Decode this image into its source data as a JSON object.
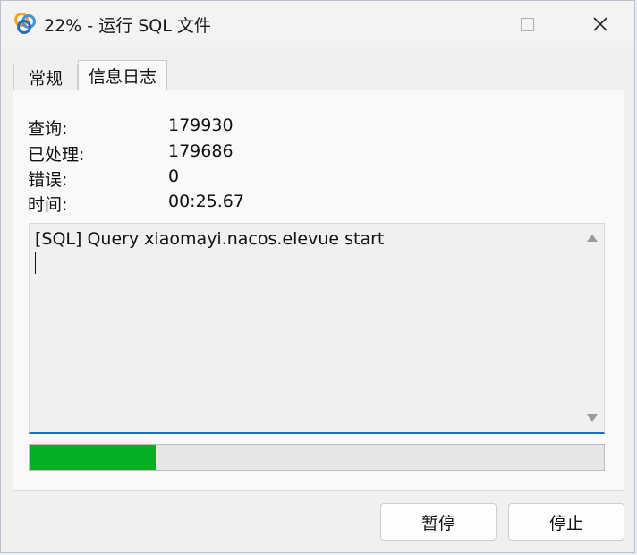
{
  "window": {
    "title": "22% - 运行 SQL 文件"
  },
  "tabs": [
    {
      "label": "常规",
      "active": false
    },
    {
      "label": "信息日志",
      "active": true
    }
  ],
  "stats": [
    {
      "label": "查询:",
      "value": "179930"
    },
    {
      "label": "已处理:",
      "value": "179686"
    },
    {
      "label": "错误:",
      "value": "0"
    },
    {
      "label": "时间:",
      "value": "00:25.67"
    }
  ],
  "log": {
    "text": "[SQL] Query xiaomayi.nacos.elevue start"
  },
  "progress": {
    "fraction": 0.22,
    "color": "#06b025"
  },
  "buttons": {
    "pause": "暂停",
    "stop": "停止"
  },
  "icons": {
    "app": "navicat-icon",
    "minimize": "minimize-icon",
    "maximize": "maximize-icon",
    "close": "close-icon"
  }
}
